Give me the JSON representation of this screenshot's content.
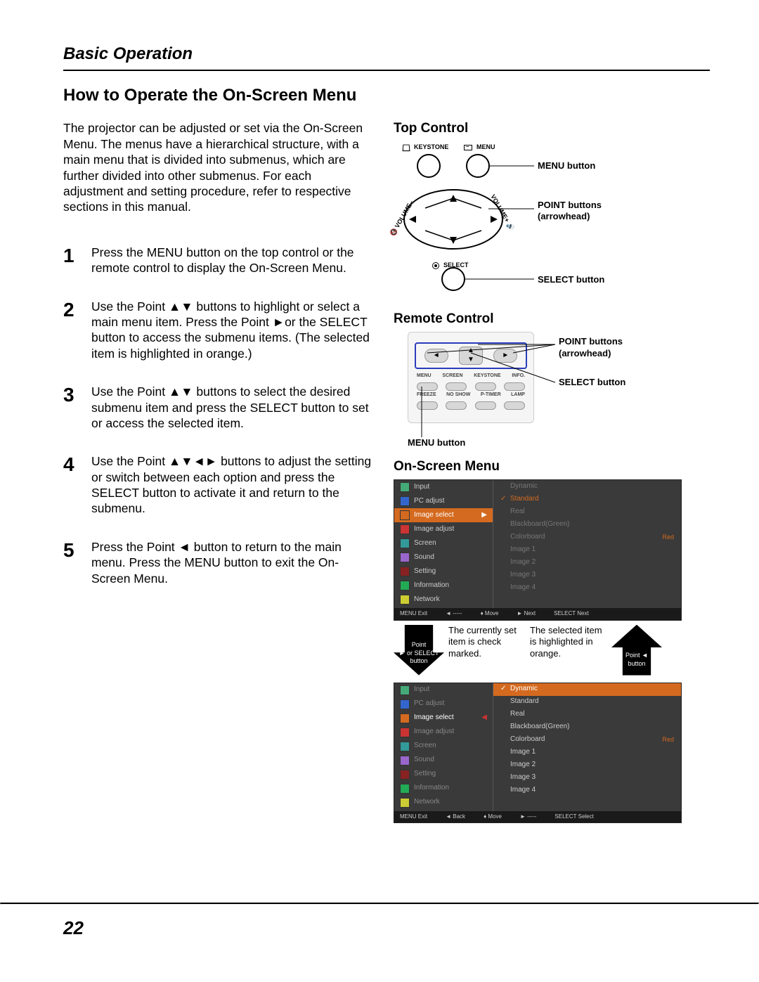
{
  "section_title": "Basic Operation",
  "page_title": "How to Operate the On-Screen Menu",
  "intro": "The projector can be adjusted or set via the On-Screen Menu. The menus have a hierarchical structure, with a main menu that is divided into submenus, which are further divided into other submenus. For each adjustment and setting procedure, refer to respective sections in this manual.",
  "steps": [
    {
      "num": "1",
      "body": "Press the MENU button on the top control or the remote control to display the On-Screen Menu."
    },
    {
      "num": "2",
      "body": "Use the Point ▲▼ buttons to highlight or select a main menu item. Press the Point ►or the SELECT button to access the submenu items. (The selected item is highlighted in orange.)"
    },
    {
      "num": "3",
      "body": "Use the Point ▲▼ buttons to select the desired submenu item and press the SELECT button to set or access the selected item."
    },
    {
      "num": "4",
      "body": "Use the Point ▲▼◄► buttons to adjust the setting or switch between each option and press the SELECT button to activate it and return to the submenu."
    },
    {
      "num": "5",
      "body": "Press the Point ◄ button to return to the main menu. Press the MENU button to exit the On-Screen Menu."
    }
  ],
  "top_control": {
    "title": "Top Control",
    "keystone": "KEYSTONE",
    "menu": "MENU",
    "select": "SELECT",
    "volume_minus": "VOLUME–",
    "volume_plus": "VOLUME+",
    "menu_button": "MENU button",
    "point_buttons": "POINT buttons (arrowhead)",
    "select_button": "SELECT button"
  },
  "remote": {
    "title": "Remote Control",
    "point_buttons": "POINT buttons (arrowhead)",
    "select_button": "SELECT button",
    "menu_button": "MENU button",
    "row1": [
      "MENU",
      "SCREEN",
      "KEYSTONE",
      "INFO."
    ],
    "row2": [
      "FREEZE",
      "NO SHOW",
      "P-TIMER",
      "LAMP"
    ]
  },
  "osm": {
    "title": "On-Screen Menu",
    "left_items": [
      "Input",
      "PC adjust",
      "Image select",
      "Image adjust",
      "Screen",
      "Sound",
      "Setting",
      "Information",
      "Network"
    ],
    "right_items": [
      "Dynamic",
      "Standard",
      "Real",
      "Blackboard(Green)",
      "Colorboard",
      "Image 1",
      "Image 2",
      "Image 3",
      "Image 4"
    ],
    "colorboard_value": "Red",
    "footer1": {
      "exit": "MENU Exit",
      "nav1": "◄ -----",
      "nav2": "♦ Move",
      "nav3": "► Next",
      "sel": "SELECT Next"
    },
    "footer2": {
      "exit": "MENU Exit",
      "nav1": "◄ Back",
      "nav2": "♦ Move",
      "nav3": "► -----",
      "sel": "SELECT Select"
    }
  },
  "annotations": {
    "arrow_left": "Point\n► or SELECT\nbutton",
    "ann1": "The currently set item is check marked.",
    "ann2": "The selected item is highlighted in orange.",
    "arrow_right": "Point ◄\nbutton"
  },
  "page_number": "22"
}
